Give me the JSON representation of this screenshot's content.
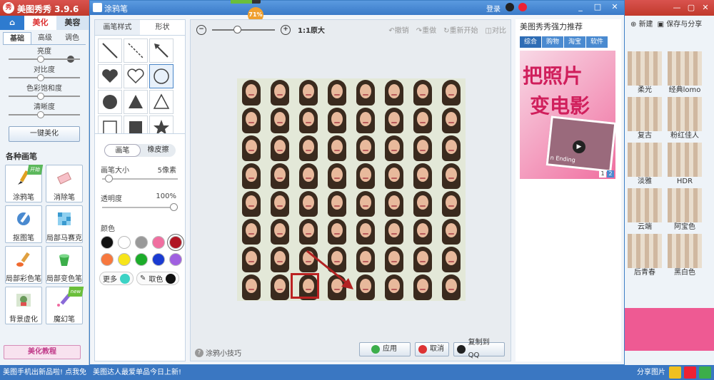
{
  "app": {
    "title": "美图秀秀 3.9.6",
    "logo": "秀",
    "tabs": [
      {
        "label": "⌂"
      },
      {
        "label": "美化"
      },
      {
        "label": "美容"
      }
    ],
    "window_controls": [
      "—",
      "▢",
      "✕"
    ]
  },
  "left_panel": {
    "sub_tabs": [
      "基础",
      "高级",
      "调色"
    ],
    "sliders": [
      {
        "label": "亮度"
      },
      {
        "label": "对比度"
      },
      {
        "label": "色彩饱和度"
      },
      {
        "label": "清晰度"
      }
    ],
    "one_key_label": "一键美化",
    "brush_section_title": "各种画笔",
    "tools": [
      {
        "label": "涂鸦笔",
        "tag": "开始",
        "icon": "brush-icon"
      },
      {
        "label": "消除笔",
        "icon": "eraser-icon"
      },
      {
        "label": "抠图笔",
        "icon": "cutout-pen-icon"
      },
      {
        "label": "局部马赛克",
        "icon": "mosaic-icon"
      },
      {
        "label": "局部彩色笔",
        "icon": "color-brush-icon"
      },
      {
        "label": "局部变色笔",
        "icon": "bucket-icon"
      },
      {
        "label": "背景虚化",
        "icon": "blur-background-icon"
      },
      {
        "label": "魔幻笔",
        "tag": "new",
        "icon": "magic-pen-icon"
      }
    ],
    "tutorial_label": "美化教程"
  },
  "dialog": {
    "title": "涂鸦笔",
    "login_label": "登录",
    "progress_percent": "71%",
    "progress_value": 0.71,
    "window_controls": [
      "_",
      "□",
      "✕"
    ],
    "options_tabs": [
      "画笔样式",
      "形状"
    ],
    "active_options_tab": 1,
    "shapes": [
      "line",
      "dashed-line",
      "arrow",
      "heart-filled",
      "heart-outline",
      "circle-outline",
      "circle-filled",
      "triangle-filled",
      "triangle-outline",
      "square-outline",
      "square-filled",
      "star-filled"
    ],
    "selected_shape": 5,
    "brush_modes": [
      "画笔",
      "橡皮擦"
    ],
    "brush_size_label": "画笔大小",
    "brush_size_value": "5像素",
    "opacity_label": "透明度",
    "opacity_value": "100%",
    "color_label": "颜色",
    "colors": [
      "#111111",
      "#ffffff",
      "#999999",
      "#f06fa0",
      "#b01522",
      "#f7783e",
      "#f7e51a",
      "#1cac2a",
      "#1a3bd1",
      "#a060e0"
    ],
    "selected_color": 4,
    "more_label": "更多",
    "more_color": "#3cd3c5",
    "pick_label": "取色",
    "pick_color": "#111111"
  },
  "canvas": {
    "zoom_label": "1:1原大",
    "edit_buttons": [
      "撤销",
      "重做",
      "重新开始",
      "对比"
    ],
    "grid_rows": 8,
    "grid_cols": 8,
    "highlight_cell": {
      "row": 7,
      "col": 2
    },
    "highlight_color": "#b22222",
    "tips_label": "涂鸦小技巧",
    "apply_label": "应用",
    "cancel_label": "取消",
    "copy_qq_label": "复制到QQ"
  },
  "recommend": {
    "title": "美图秀秀强力推荐",
    "tabs": [
      "综合",
      "购物",
      "淘宝",
      "软件"
    ],
    "banner_line1": "把照片",
    "banner_line2": "变电影",
    "banner_caption": "n Ending",
    "pages": [
      "1",
      "2"
    ]
  },
  "right_panel": {
    "new_label": "新建",
    "save_label": "保存与分享",
    "effects": [
      "柔光",
      "经典lomo",
      "复古",
      "粉红佳人",
      "淡雅",
      "HDR",
      "云端",
      "阿宝色",
      "后青春",
      "黑白色"
    ],
    "share_label": "分享图片"
  },
  "status": {
    "left_text": "美图手机出新品啦! 点我免",
    "mid_text": "美图达人最爱单品今日上新!",
    "right_text": "分享图片"
  }
}
